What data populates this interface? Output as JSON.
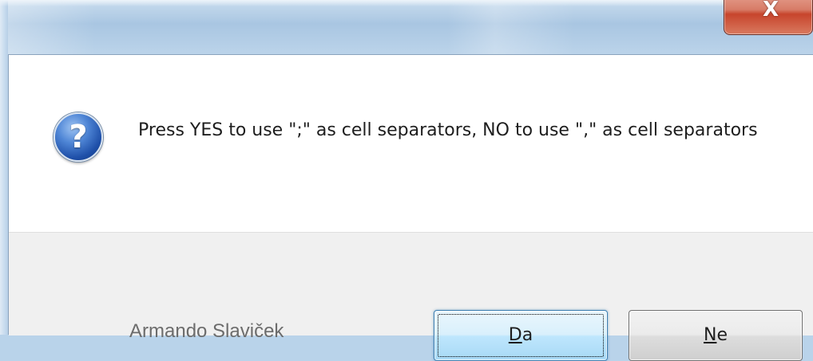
{
  "window": {
    "close_glyph": "X"
  },
  "dialog": {
    "icon": "question-icon",
    "icon_glyph": "?",
    "message": "Press YES to use \";\" as cell separators, NO to use \",\" as cell separators"
  },
  "buttons": {
    "yes": {
      "mnemonic": "D",
      "rest": "a"
    },
    "no": {
      "mnemonic": "N",
      "rest": "e"
    }
  },
  "background": {
    "caption": "Armando Slaviček"
  },
  "colors": {
    "close_button": "#c7452c",
    "default_button_border": "#3c7fb1"
  }
}
